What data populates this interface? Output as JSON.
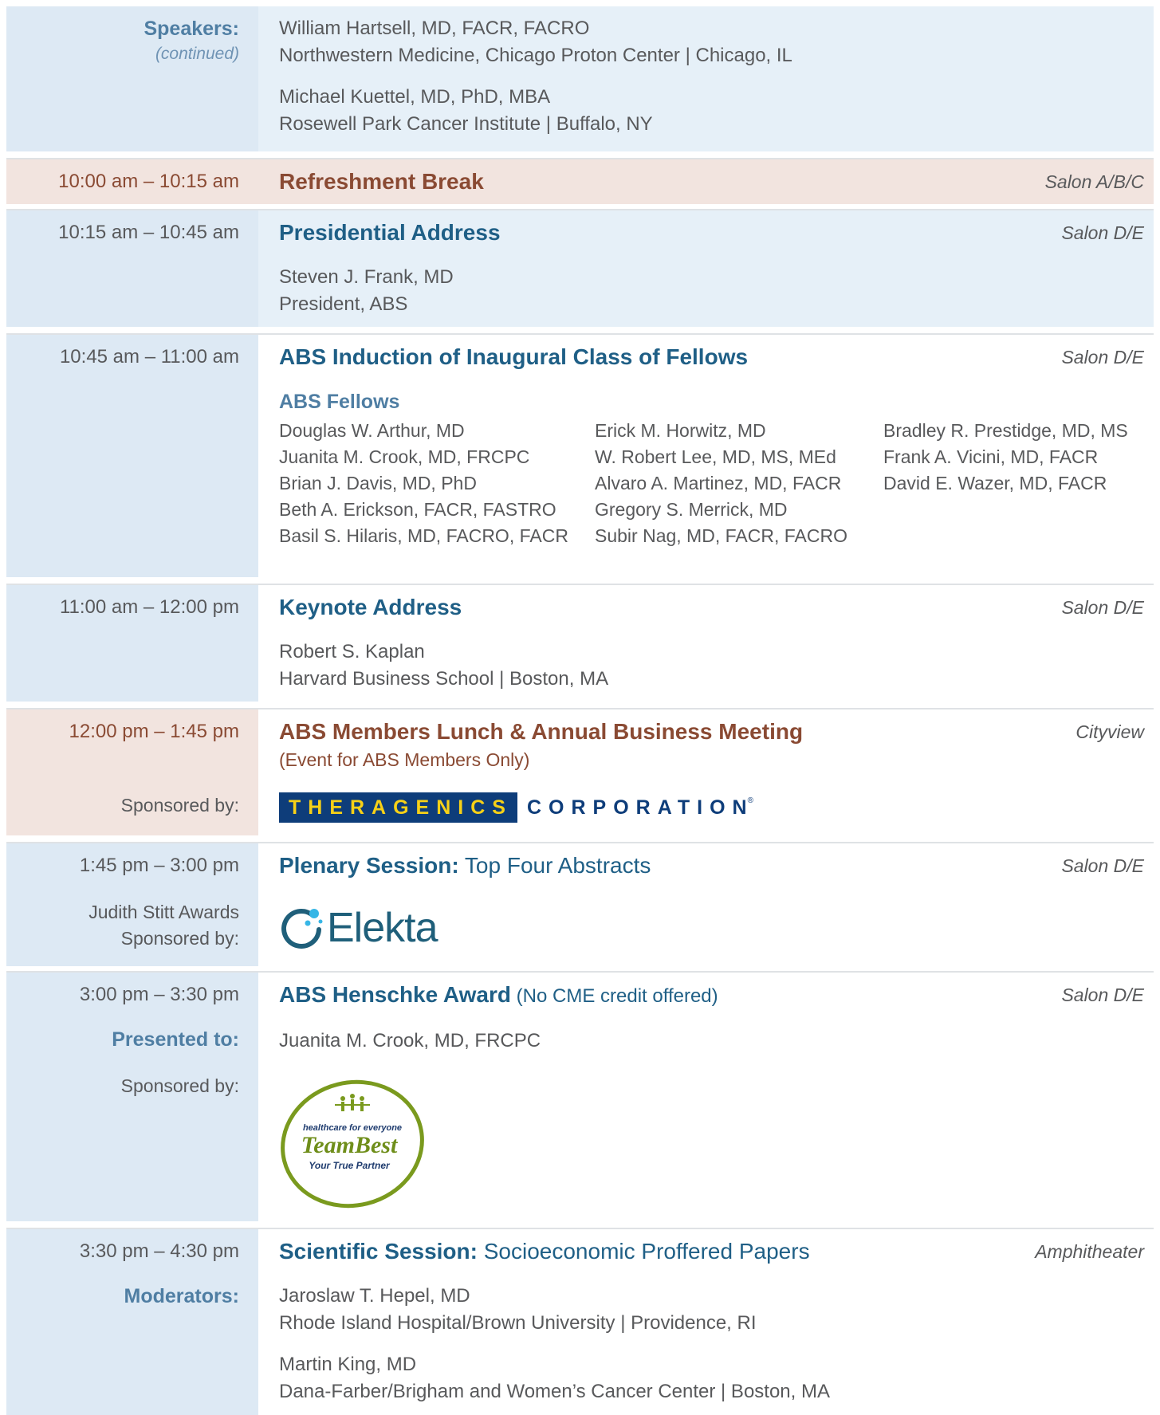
{
  "speakers_cont": {
    "label": "Speakers:",
    "sublabel": "(continued)",
    "p1_name": "William Hartsell, MD, FACR, FACRO",
    "p1_org": "Northwestern Medicine, Chicago Proton Center | Chicago, IL",
    "p2_name": "Michael Kuettel, MD, PhD, MBA",
    "p2_org": "Rosewell Park Cancer Institute | Buffalo, NY"
  },
  "break": {
    "time": "10:00 am – 10:15 am",
    "title": "Refreshment Break",
    "room": "Salon A/B/C"
  },
  "presidential": {
    "time": "10:15 am – 10:45 am",
    "title": "Presidential Address",
    "room": "Salon D/E",
    "name": "Steven J. Frank, MD",
    "role": "President, ABS"
  },
  "induction": {
    "time": "10:45 am – 11:00 am",
    "title": "ABS Induction of Inaugural Class of Fellows",
    "room": "Salon D/E",
    "fellows_heading": "ABS Fellows",
    "col1": [
      "Douglas W. Arthur, MD",
      "Juanita M. Crook, MD, FRCPC",
      "Brian J. Davis, MD, PhD",
      "Beth A. Erickson, FACR, FASTRO",
      "Basil S. Hilaris, MD, FACRO, FACR"
    ],
    "col2": [
      "Erick M. Horwitz, MD",
      "W. Robert Lee, MD, MS, MEd",
      "Alvaro A. Martinez, MD, FACR",
      "Gregory S. Merrick, MD",
      "Subir Nag, MD, FACR, FACRO"
    ],
    "col3": [
      "Bradley R. Prestidge, MD, MS",
      "Frank A. Vicini, MD, FACR",
      "David E. Wazer, MD, FACR"
    ]
  },
  "keynote": {
    "time": "11:00 am – 12:00 pm",
    "title": "Keynote Address",
    "room": "Salon D/E",
    "name": "Robert S. Kaplan",
    "org": "Harvard Business School | Boston, MA"
  },
  "lunch": {
    "time": "12:00 pm – 1:45 pm",
    "title": "ABS Members Lunch & Annual Business Meeting",
    "subtitle": "(Event for ABS Members Only)",
    "room": "Cityview",
    "sponsor_label": "Sponsored by:",
    "logo_a": "THERAGENICS",
    "logo_b": "CORPORATION"
  },
  "plenary": {
    "time": "1:45 pm – 3:00 pm",
    "title_bold": "Plenary Session:",
    "title_rest": " Top Four Abstracts",
    "room": "Salon D/E",
    "award_label_1": "Judith Stitt Awards",
    "award_label_2": "Sponsored by:",
    "logo": "Elekta"
  },
  "henschke": {
    "time": "3:00 pm – 3:30 pm",
    "title_bold": "ABS Henschke Award",
    "title_rest": " (No CME credit offered)",
    "room": "Salon D/E",
    "presented_label": "Presented to:",
    "presented_name": "Juanita M. Crook, MD, FRCPC",
    "sponsor_label": "Sponsored by:",
    "logo_tagline": "healthcare for everyone",
    "logo_name": "TeamBest",
    "logo_sub": "Your True Partner"
  },
  "scientific": {
    "time": "3:30 pm – 4:30 pm",
    "title_bold": "Scientific Session:",
    "title_rest": " Socioeconomic Proffered Papers",
    "room": "Amphitheater",
    "mod_label": "Moderators:",
    "m1_name": "Jaroslaw T. Hepel, MD",
    "m1_org": "Rhode Island Hospital/Brown University | Providence, RI",
    "m2_name": "Martin King, MD",
    "m2_org": "Dana-Farber/Brigham and Women’s Cancer Center | Boston, MA"
  }
}
